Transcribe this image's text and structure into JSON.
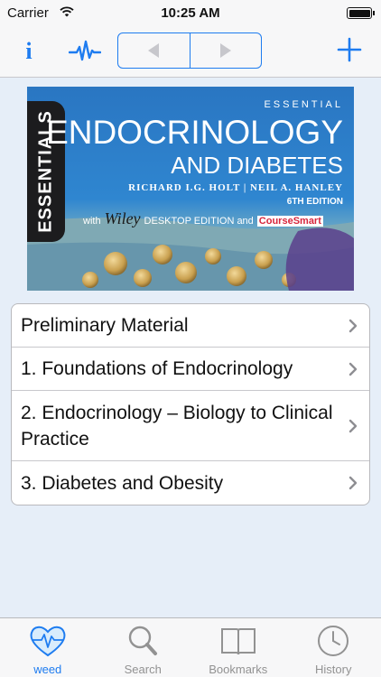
{
  "status_bar": {
    "carrier": "Carrier",
    "time": "10:25 AM"
  },
  "toolbar": {
    "info_label": "i",
    "icons": [
      "info-icon",
      "pulse-icon",
      "back-arrow-icon",
      "forward-arrow-icon",
      "add-icon"
    ]
  },
  "cover": {
    "series": "ESSENTIALS",
    "essential": "ESSENTIAL",
    "title_line1": "ENDOCRINOLOGY",
    "title_line2": "AND DIABETES",
    "authors": "RICHARD I.G. HOLT | NEIL A. HANLEY",
    "edition": "6TH EDITION",
    "with": "with",
    "publisher": "Wiley",
    "desktop": "DESKTOP EDITION and",
    "coursesmart": "CourseSmart"
  },
  "contents": [
    {
      "label": "Preliminary Material"
    },
    {
      "label": "1. Foundations of Endocrinology"
    },
    {
      "label": "2. Endocrinology – Biology to Clinical Practice"
    },
    {
      "label": "3. Diabetes and Obesity"
    }
  ],
  "tabs": [
    {
      "label": "weed",
      "icon": "heart-icon",
      "active": true
    },
    {
      "label": "Search",
      "icon": "search-icon",
      "active": false
    },
    {
      "label": "Bookmarks",
      "icon": "book-icon",
      "active": false
    },
    {
      "label": "History",
      "icon": "clock-icon",
      "active": false
    }
  ],
  "colors": {
    "accent": "#1e7cf0",
    "background": "#e6eef8",
    "tab_inactive": "#929292"
  }
}
